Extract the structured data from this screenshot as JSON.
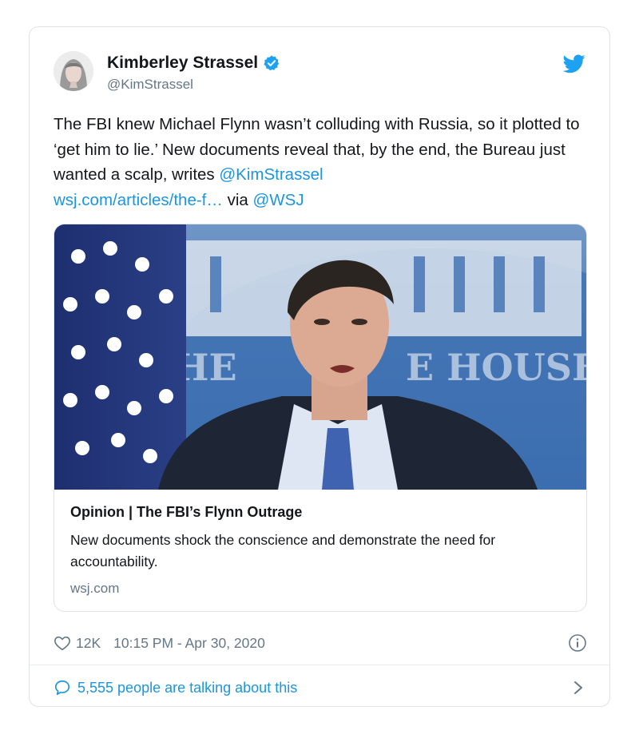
{
  "author": {
    "name": "Kimberley Strassel",
    "handle": "@KimStrassel"
  },
  "tweet": {
    "text_1": "The FBI knew Michael Flynn wasn’t colluding with Russia, so it plotted to ‘get him to lie.’ New documents reveal that, by the end, the Bureau just wanted a scalp, writes ",
    "mention_author": "@KimStrassel",
    "url": "wsj.com/articles/the-f…",
    "via": " via ",
    "mention_wsj": "@WSJ"
  },
  "card": {
    "title": "Opinion | The FBI’s Flynn Outrage",
    "description": "New documents shock the conscience and demonstrate the need for accountability.",
    "domain": "wsj.com"
  },
  "meta": {
    "likes": "12K",
    "timestamp": "10:15 PM - Apr 30, 2020"
  },
  "footer": {
    "talking": "5,555 people are talking about this"
  },
  "colors": {
    "link": "#1b95e0",
    "verified": "#1da1f2",
    "muted": "#657786"
  },
  "icons": [
    "verified-badge-icon",
    "twitter-bird-icon",
    "heart-icon",
    "info-icon",
    "speech-bubble-icon",
    "chevron-right-icon"
  ]
}
